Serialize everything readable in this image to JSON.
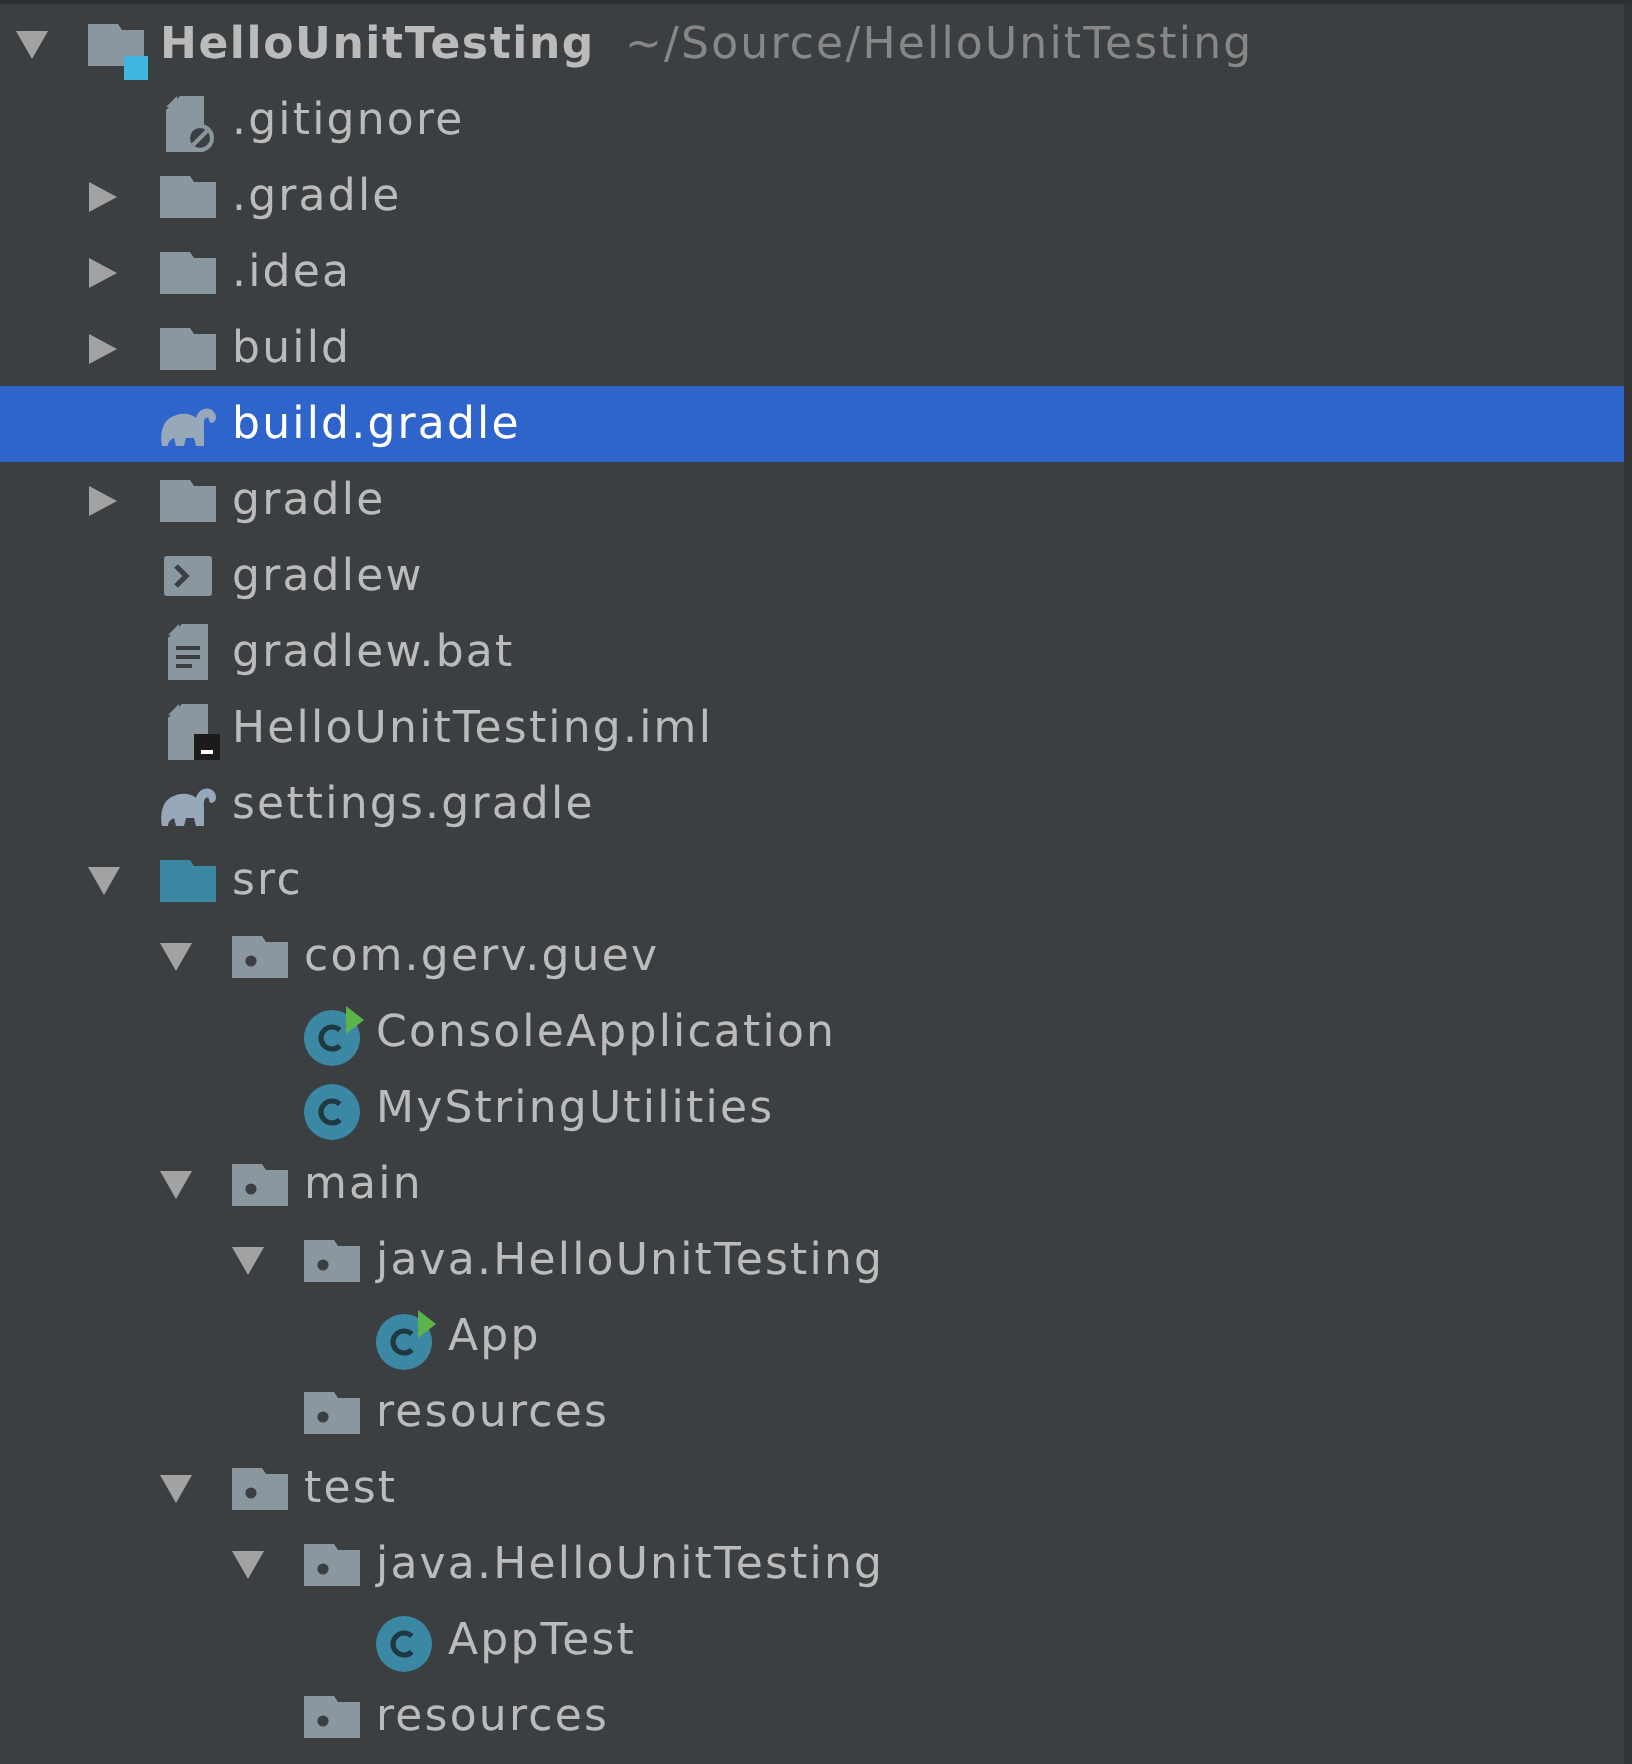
{
  "project_tree": [
    {
      "label": "HelloUnitTesting",
      "path": "~/Source/HelloUnitTesting",
      "kind": "module",
      "expanded": true,
      "selected": false,
      "children": [
        {
          "label": ".gitignore",
          "kind": "ignored-file",
          "selected": false
        },
        {
          "label": ".gradle",
          "kind": "folder",
          "expanded": false,
          "selected": false
        },
        {
          "label": ".idea",
          "kind": "folder",
          "expanded": false,
          "selected": false
        },
        {
          "label": "build",
          "kind": "folder",
          "expanded": false,
          "selected": false
        },
        {
          "label": "build.gradle",
          "kind": "gradle",
          "selected": true
        },
        {
          "label": "gradle",
          "kind": "folder",
          "expanded": false,
          "selected": false
        },
        {
          "label": "gradlew",
          "kind": "shell-script",
          "selected": false
        },
        {
          "label": "gradlew.bat",
          "kind": "text-file",
          "selected": false
        },
        {
          "label": "HelloUnitTesting.iml",
          "kind": "module-file",
          "selected": false
        },
        {
          "label": "settings.gradle",
          "kind": "gradle",
          "selected": false
        },
        {
          "label": "src",
          "kind": "source-folder",
          "expanded": true,
          "selected": false,
          "children": [
            {
              "label": "com.gerv.guev",
              "kind": "package",
              "expanded": true,
              "selected": false,
              "children": [
                {
                  "label": "ConsoleApplication",
                  "kind": "runnable-class",
                  "selected": false
                },
                {
                  "label": "MyStringUtilities",
                  "kind": "class",
                  "selected": false
                }
              ]
            },
            {
              "label": "main",
              "kind": "package",
              "expanded": true,
              "selected": false,
              "children": [
                {
                  "label": "java.HelloUnitTesting",
                  "kind": "package",
                  "expanded": true,
                  "selected": false,
                  "children": [
                    {
                      "label": "App",
                      "kind": "runnable-class",
                      "selected": false
                    }
                  ]
                },
                {
                  "label": "resources",
                  "kind": "package",
                  "selected": false
                }
              ]
            },
            {
              "label": "test",
              "kind": "package",
              "expanded": true,
              "selected": false,
              "children": [
                {
                  "label": "java.HelloUnitTesting",
                  "kind": "package",
                  "expanded": true,
                  "selected": false,
                  "children": [
                    {
                      "label": "AppTest",
                      "kind": "class",
                      "selected": false
                    }
                  ]
                },
                {
                  "label": "resources",
                  "kind": "package",
                  "selected": false
                }
              ]
            }
          ]
        }
      ]
    }
  ]
}
